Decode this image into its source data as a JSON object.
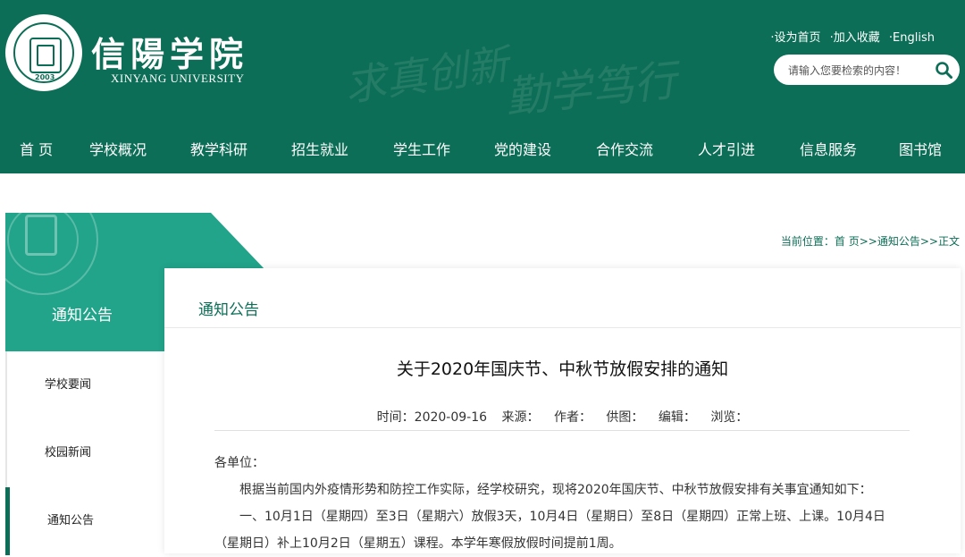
{
  "header": {
    "logo_cn": "信陽学院",
    "logo_en": "XINYANG UNIVERSITY",
    "emblem_year": "2003",
    "slogan_line1": "求真创新",
    "slogan_line2": "勤学笃行",
    "links": [
      "·设为首页",
      "·加入收藏",
      "·English"
    ],
    "search_placeholder": "请输入您要检索的内容！"
  },
  "nav": {
    "items": [
      "首 页",
      "学校概况",
      "教学科研",
      "招生就业",
      "学生工作",
      "党的建设",
      "合作交流",
      "人才引进",
      "信息服务",
      "图书馆"
    ]
  },
  "sidebar": {
    "title": "通知公告",
    "items": [
      {
        "label": "学校要闻"
      },
      {
        "label": "校园新闻"
      },
      {
        "label": "通知公告"
      }
    ]
  },
  "breadcrumb": {
    "prefix": "当前位置：",
    "home": "首 页",
    "sep1": ">>",
    "section": "通知公告",
    "sep2": ">>",
    "current": "正文"
  },
  "article": {
    "section_title": "通知公告",
    "title": "关于2020年国庆节、中秋节放假安排的通知",
    "meta": {
      "time": "时间：2020-09-16",
      "source": "来源：",
      "author": "作者：",
      "image": "供图：",
      "editor": "编辑：",
      "views": "浏览："
    },
    "greeting": "各单位：",
    "para1": "根据当前国内外疫情形势和防控工作实际，经学校研究，现将2020年国庆节、中秋节放假安排有关事宜通知如下：",
    "para2_line1": "一、10月1日（星期四）至3日（星期六）放假3天，10月4日（星期日）至8日（星期四）正常上班、上课。10月4日",
    "para2_line2": "（星期日）补上10月2日（星期五）课程。本学年寒假放假时间提前1周。"
  },
  "colors": {
    "primary": "#0c6e56",
    "banner": "#22a48a"
  }
}
